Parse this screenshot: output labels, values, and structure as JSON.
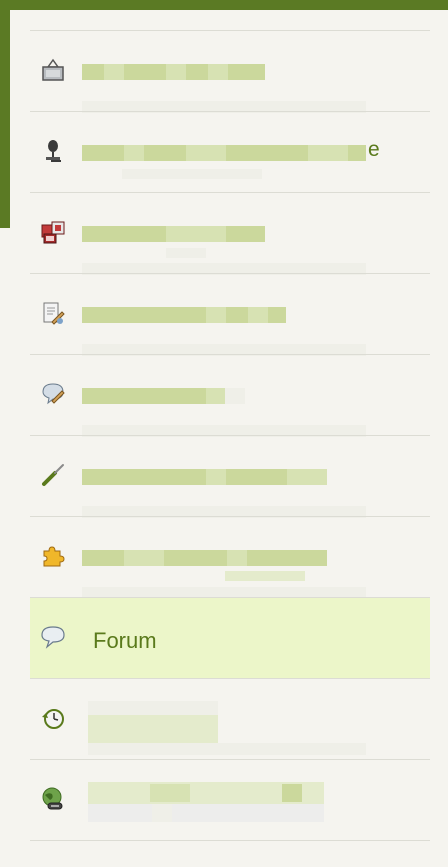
{
  "menu": {
    "items": [
      {
        "name": "menu-item-1",
        "icon": "frame-icon",
        "label": ""
      },
      {
        "name": "menu-item-2",
        "icon": "microphone-icon",
        "label": "",
        "tail": "e"
      },
      {
        "name": "menu-item-3",
        "icon": "gallery-icon",
        "label": ""
      },
      {
        "name": "menu-item-4",
        "icon": "document-edit-icon",
        "label": ""
      },
      {
        "name": "menu-item-5",
        "icon": "chat-edit-icon",
        "label": ""
      },
      {
        "name": "menu-item-6",
        "icon": "screwdriver-icon",
        "label": ""
      },
      {
        "name": "menu-item-7",
        "icon": "puzzle-icon",
        "label": ""
      },
      {
        "name": "menu-item-forum",
        "icon": "chat-bubble-icon",
        "label": "Forum"
      },
      {
        "name": "menu-item-9",
        "icon": "history-clock-icon",
        "label": ""
      },
      {
        "name": "menu-item-10",
        "icon": "globe-link-icon",
        "label": ""
      }
    ]
  },
  "colors": {
    "brand_green": "#5b7a24",
    "active_background": "#ecf6c9",
    "label_green": "#5a7a1c"
  }
}
